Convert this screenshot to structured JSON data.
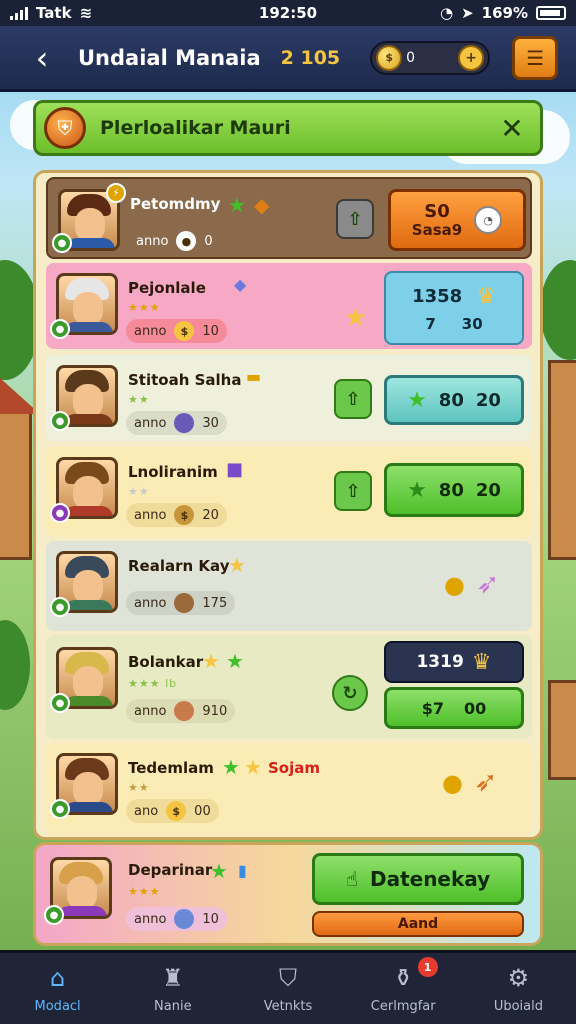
{
  "status_bar": {
    "carrier": "Tatk",
    "time": "192:50",
    "battery": "169%"
  },
  "header": {
    "title": "Undaial Manaia",
    "value": "2 105",
    "coin_amount": "0",
    "add_label": "+"
  },
  "banner": {
    "title": "Plerloalikar Mauri"
  },
  "players": [
    {
      "name": "Petomdmy",
      "stats_label": "anno",
      "stats_value": "0",
      "button_top": "S0",
      "button_bottom": "Sasa9"
    },
    {
      "name": "Pejonlale",
      "stars": "★★★",
      "stats_label": "anno",
      "stats_value": "10",
      "badge_top": "1358",
      "badge_left": "7",
      "badge_right": "30"
    },
    {
      "name": "Stitoah Salha",
      "stars": "★★",
      "stats_label": "anno",
      "stats_value": "30",
      "button_left": "80",
      "button_right": "20"
    },
    {
      "name": "Lnoliranim",
      "stars": "★★",
      "stats_label": "anno",
      "stats_value": "20",
      "button_left": "80",
      "button_right": "20"
    },
    {
      "name": "Realarn Kay",
      "stats_label": "anno",
      "stats_value": "175"
    },
    {
      "name": "Bolankar",
      "stars": "★★★ lb",
      "stats_label": "anno",
      "stats_value": "910",
      "badge_top": "1319",
      "button_left": "$7",
      "button_right": "00"
    },
    {
      "name": "Tedemlam",
      "tag": "Sojam",
      "stars": "★★",
      "stats_label": "ano",
      "stats_value": "00"
    }
  ],
  "footer_player": {
    "name": "Deparinar",
    "stars": "★★★",
    "stats_label": "anno",
    "stats_value": "10",
    "main_button": "Datenekay",
    "sub_button": "Aand"
  },
  "nav": [
    {
      "label": "Modacl"
    },
    {
      "label": "Nanie"
    },
    {
      "label": "Vetnkts"
    },
    {
      "label": "Cerlmgfar",
      "badge": "1"
    },
    {
      "label": "Uboiald"
    }
  ]
}
